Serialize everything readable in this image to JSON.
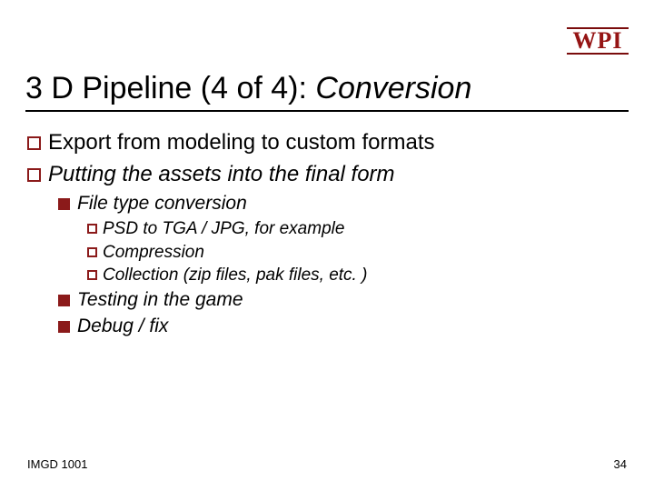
{
  "logo_text": "WPI",
  "title_plain": "3 D Pipeline (4 of 4): ",
  "title_italic": "Conversion",
  "bullets": {
    "b1": "Export from modeling to custom formats",
    "b2": "Putting the assets into the final form",
    "b2_1": "File type conversion",
    "b2_1_1": "PSD to TGA / JPG, for example",
    "b2_1_2": "Compression",
    "b2_1_3": "Collection (zip files, pak files, etc. )",
    "b2_2": "Testing in the game",
    "b2_3": "Debug / fix"
  },
  "footer_left": "IMGD 1001",
  "footer_right": "34"
}
